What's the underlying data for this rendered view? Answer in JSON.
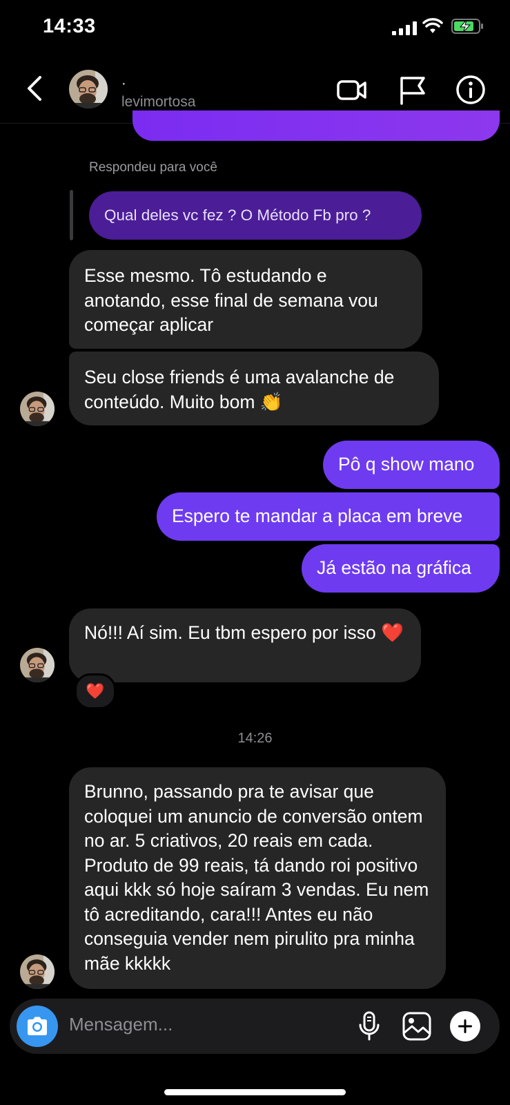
{
  "status_bar": {
    "time": "14:33"
  },
  "header": {
    "name_line": "·",
    "username": "levimortosa"
  },
  "reply": {
    "note": "Respondeu para você",
    "quoted_text": "Qual deles vc fez ? O Método Fb pro ?"
  },
  "messages": [
    {
      "side": "in",
      "text": "Esse mesmo. Tô estudando e anotando, esse final de semana vou começar aplicar"
    },
    {
      "side": "in",
      "text": "Seu close friends é uma avalanche de conteúdo. Muito bom 👏"
    },
    {
      "side": "out",
      "text": "Pô q show mano"
    },
    {
      "side": "out",
      "text": "Espero te mandar a placa em breve"
    },
    {
      "side": "out",
      "text": "Já estão na gráfica"
    },
    {
      "side": "in",
      "text": "Nó!!! Aí sim. Eu tbm espero por isso ❤️"
    },
    {
      "side": "in",
      "text": "Brunno, passando pra te avisar que coloquei um anuncio de conversão ontem no ar. 5 criativos, 20 reais em cada. Produto de 99 reais, tá dando roi positivo aqui kkk só hoje saíram 3 vendas. Eu nem tô acreditando, cara!!! Antes eu não conseguia vender nem pirulito pra minha mãe kkkkk"
    }
  ],
  "reaction": "❤️",
  "timestamp": "14:26",
  "composer": {
    "placeholder": "Mensagem..."
  },
  "icons": [
    "back-icon",
    "video-call-icon",
    "flag-icon",
    "info-icon",
    "camera-icon",
    "microphone-icon",
    "gallery-icon",
    "plus-icon"
  ],
  "colors": {
    "outgoing": "#6e3bf1",
    "incoming": "#262626",
    "camera": "#3797f0",
    "background": "#000000"
  }
}
